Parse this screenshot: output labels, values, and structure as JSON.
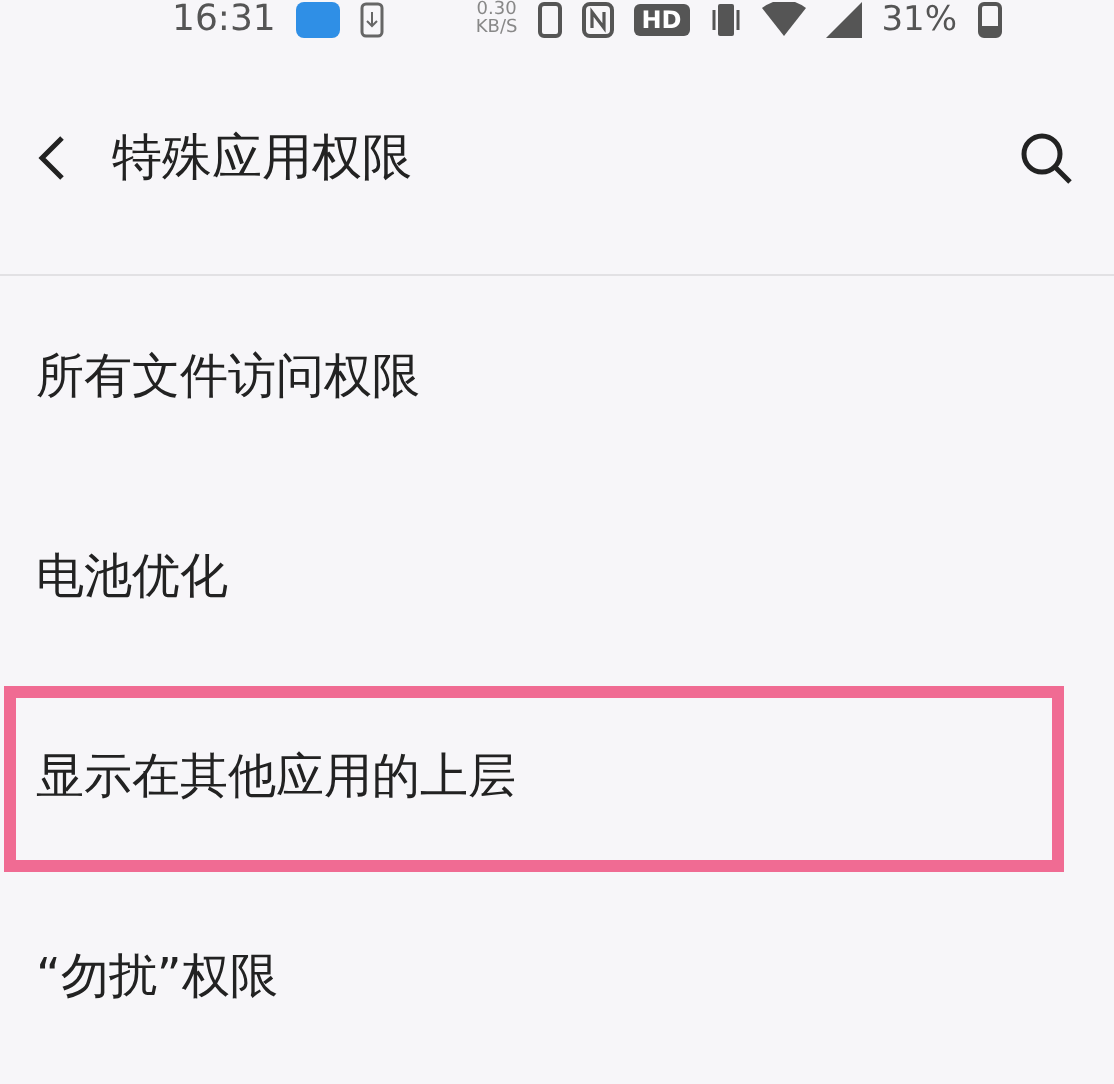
{
  "status_bar": {
    "time": "16:31",
    "speed": "0.30",
    "speed_unit": "KB/S",
    "hd": "HD",
    "battery": "31%"
  },
  "header": {
    "title": "特殊应用权限"
  },
  "items": [
    {
      "label": "所有文件访问权限",
      "highlighted": false
    },
    {
      "label": "电池优化",
      "highlighted": false
    },
    {
      "label": "显示在其他应用的上层",
      "highlighted": true
    },
    {
      "label": "“勿扰”权限",
      "highlighted": false
    }
  ]
}
